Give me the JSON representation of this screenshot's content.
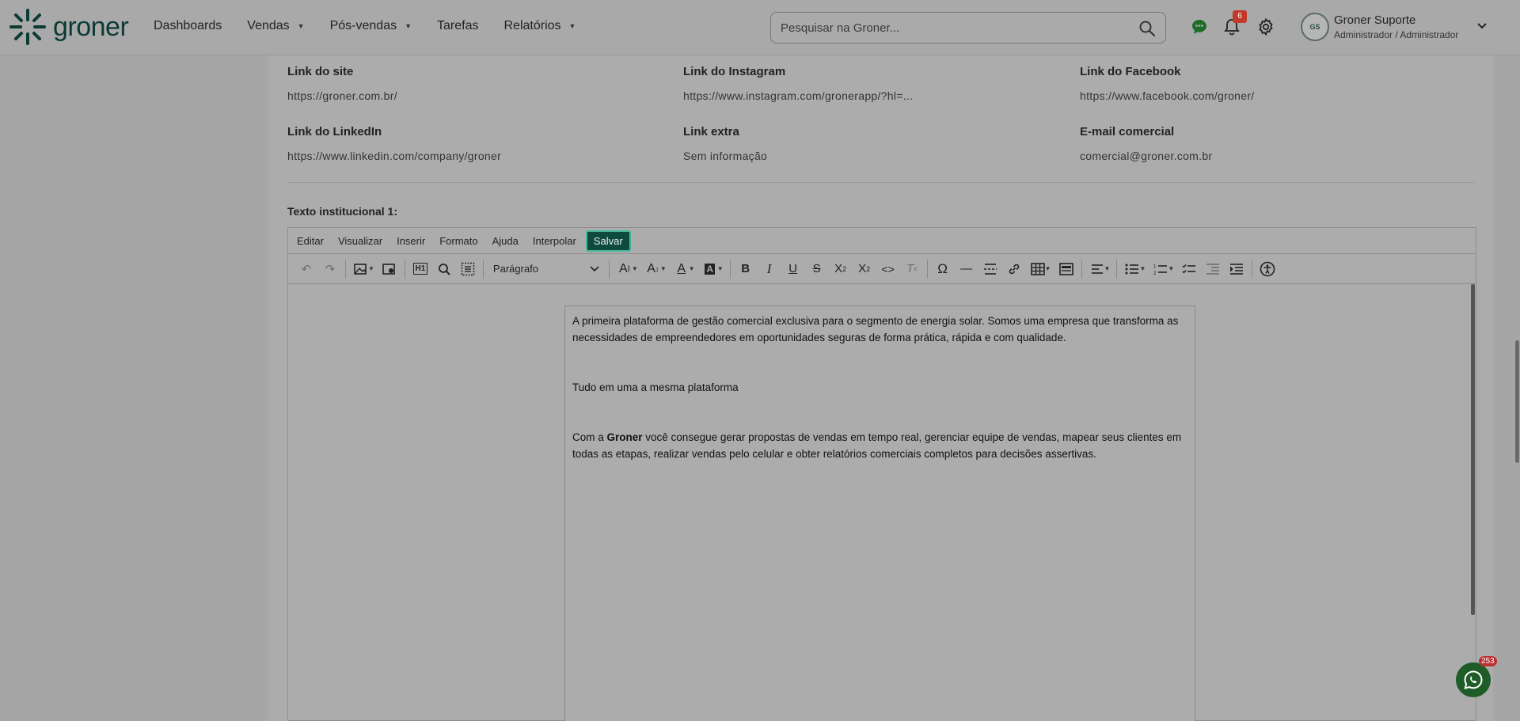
{
  "brand": {
    "name": "groner"
  },
  "nav": [
    {
      "label": "Dashboards",
      "dropdown": false
    },
    {
      "label": "Vendas",
      "dropdown": true
    },
    {
      "label": "Pós-vendas",
      "dropdown": true
    },
    {
      "label": "Tarefas",
      "dropdown": false
    },
    {
      "label": "Relatórios",
      "dropdown": true
    }
  ],
  "search": {
    "placeholder": "Pesquisar na Groner..."
  },
  "notifications": {
    "count": "6"
  },
  "user": {
    "name": "Groner Suporte",
    "role": "Administrador / Administrador"
  },
  "fields": [
    {
      "label": "Link do site",
      "value": "https://groner.com.br/"
    },
    {
      "label": "Link do Instagram",
      "value": "https://www.instagram.com/gronerapp/?hl=..."
    },
    {
      "label": "Link do Facebook",
      "value": "https://www.facebook.com/groner/"
    },
    {
      "label": "Link do LinkedIn",
      "value": "https://www.linkedin.com/company/groner"
    },
    {
      "label": "Link extra",
      "value": "Sem informação"
    },
    {
      "label": "E-mail comercial",
      "value": "comercial@groner.com.br"
    }
  ],
  "section": {
    "title": "Texto institucional 1:"
  },
  "editor": {
    "menu": [
      "Editar",
      "Visualizar",
      "Inserir",
      "Formato",
      "Ajuda",
      "Interpolar"
    ],
    "save_label": "Salvar",
    "block_format": "Parágrafo",
    "content": {
      "p1": "A primeira plataforma de gestão comercial exclusiva para o segmento de energia solar. Somos uma empresa que transforma as necessidades de empreendedores em oportunidades seguras de forma prática, rápida e com qualidade.",
      "p2": "Tudo em uma a mesma plataforma",
      "p3_prefix": "Com a ",
      "p3_bold": "Groner",
      "p3_rest": " você consegue gerar propostas de vendas em tempo real, gerenciar equipe de vendas, mapear seus clientes em todas as etapas, realizar vendas pelo celular e obter relatórios comerciais completos para decisões assertivas."
    }
  },
  "whatsapp": {
    "badge": "253"
  },
  "colors": {
    "brand_dark": "#0f4a3f",
    "save_border": "#45b59a",
    "badge_red": "#c0392b"
  }
}
